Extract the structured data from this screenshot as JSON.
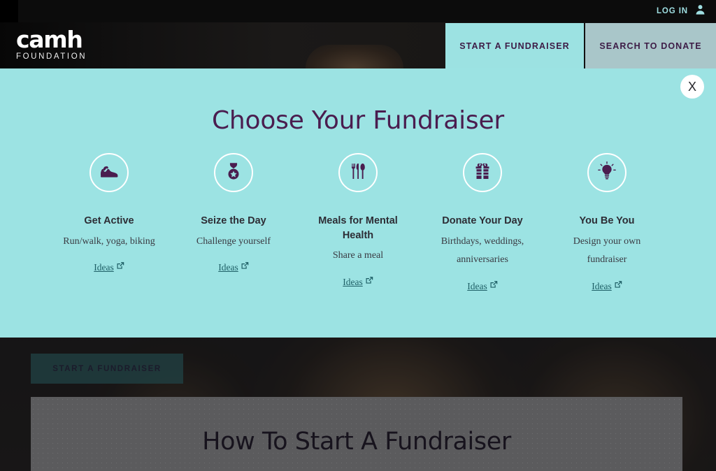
{
  "topbar": {
    "login_label": "LOG IN",
    "avatar_icon": "user-avatar-icon"
  },
  "logo": {
    "word": "camh",
    "sub": "FOUNDATION"
  },
  "nav": {
    "tabs": [
      {
        "label": "START A FUNDRAISER",
        "state": "active"
      },
      {
        "label": "SEARCH TO DONATE",
        "state": "muted"
      }
    ]
  },
  "modal": {
    "title": "Choose Your Fundraiser",
    "close_label": "X",
    "accent_bg": "#9ce3e3",
    "icon_color": "#4a1d4f",
    "cards": [
      {
        "icon": "running-shoe-icon",
        "title": "Get Active",
        "desc": "Run/walk, yoga, biking",
        "link_label": "Ideas"
      },
      {
        "icon": "medal-icon",
        "title": "Seize the Day",
        "desc": "Challenge yourself",
        "link_label": "Ideas"
      },
      {
        "icon": "cutlery-icon",
        "title": "Meals for Mental Health",
        "desc": "Share a meal",
        "link_label": "Ideas"
      },
      {
        "icon": "gift-box-icon",
        "title": "Donate Your Day",
        "desc": "Birthdays, weddings, anniversaries",
        "link_label": "Ideas"
      },
      {
        "icon": "lightbulb-icon",
        "title": "You Be You",
        "desc": "Design your own fundraiser",
        "link_label": "Ideas"
      }
    ]
  },
  "lower": {
    "cta_label": "START A FUNDRAISER",
    "panel_heading": "How To Start A Fundraiser"
  }
}
